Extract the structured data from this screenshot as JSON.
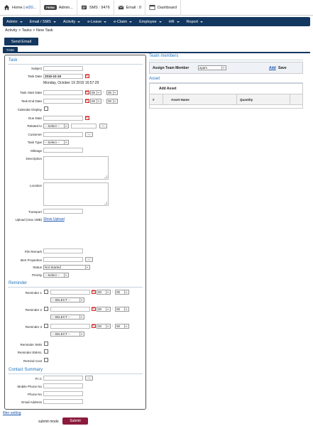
{
  "topbar": {
    "home_prefix": "Home | ",
    "home_link": "el20...",
    "perm_badge": "PERM",
    "admin_label": "Admin...",
    "sms_label": "SMS : 9476",
    "email_label": "Email : 0",
    "dashboard_label": "Dashboard"
  },
  "nav": [
    "Admin",
    "Email / SMS",
    "Activity",
    "e-Leave",
    "e-Claim",
    "Employee",
    "HR",
    "Report"
  ],
  "breadcrumb": "Activity > Tasks > New Task",
  "send_email_label": "Send Email",
  "tab_label": "TASK",
  "task": {
    "section_title": "Task",
    "subject_label": "Subject",
    "task_date_label": "Task Date",
    "task_date_value": "2015-10-19",
    "task_date_long": "Monday, October 19 2015 16:57:29",
    "start_date_label": "Task Start Date",
    "end_date_label": "Task End Date",
    "hour_value": "00",
    "minute_value": "00",
    "calendar_display_label": "Calendar Display",
    "due_date_label": "Due Date",
    "related_to_label": "Related to",
    "related_select": "-- Select --",
    "customer_label": "Customer",
    "task_type_label": "Task Type",
    "task_type_select": "-- Select --",
    "mileage_label": "Mileage",
    "description_label": "Description",
    "location_label": "Location",
    "transport_label": "Transport",
    "upload_label": "Upload (max 1MB)",
    "show_upload_link": "Show Upload",
    "file_remark_label": "File Remark",
    "item_properties_label": "Item Properties",
    "status_label": "Status",
    "status_value": "Not Started",
    "priority_label": "Priority",
    "priority_value": "-- Select --",
    "dots_label": "..."
  },
  "reminder": {
    "section_title": "Reminder",
    "items": [
      {
        "label": "Reminder 1",
        "select": "-- SELECT --"
      },
      {
        "label": "Reminder 2",
        "select": "-- SELECT --"
      },
      {
        "label": "Reminder 3",
        "select": "-- SELECT --"
      }
    ],
    "sms_label": "Reminder SMS",
    "email_label": "Reminder EMAIL",
    "cust_label": "Remind Cust"
  },
  "contact": {
    "section_title": "Contact Summary",
    "pic_label": "P.I.C",
    "mobile_label": "Mobile Phone No",
    "phone_label": "Phone No",
    "email_label": "Email Address"
  },
  "team": {
    "title": "Team members",
    "assign_label": "Assign Team Member",
    "assign_value": "ayam",
    "add_label": "Add",
    "save_label": "Save"
  },
  "asset": {
    "title": "Asset",
    "add_asset_label": "Add Asset",
    "columns": [
      "#",
      "Asset Name",
      "Quantity",
      ""
    ]
  },
  "footer": {
    "filter_setting": "filter setting",
    "submit_mode_label": "submit mode",
    "submit_label": "Submit"
  }
}
